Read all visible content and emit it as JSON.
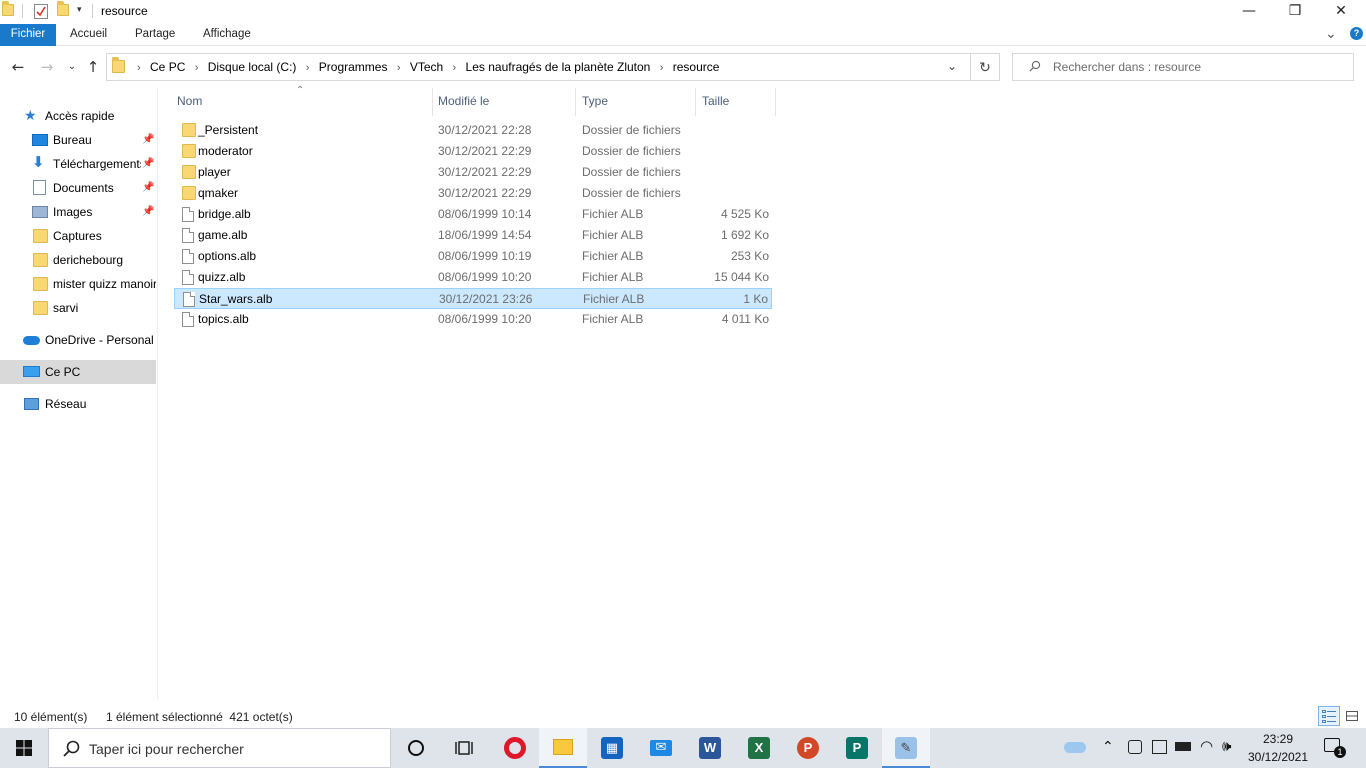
{
  "window": {
    "title": "resource",
    "minimize": "—",
    "restore": "❐",
    "close": "✕"
  },
  "ribbon": {
    "tabs": [
      "Fichier",
      "Accueil",
      "Partage",
      "Affichage"
    ],
    "expand_icon": "⌄",
    "help_icon": "?"
  },
  "address": {
    "crumbs": [
      "Ce PC",
      "Disque local (C:)",
      "Programmes",
      "VTech",
      "Les naufragés de la planète Zluton",
      "resource"
    ],
    "search_placeholder": "Rechercher dans : resource"
  },
  "nav": {
    "quick_access": "Accès rapide",
    "quick_items": [
      "Bureau",
      "Téléchargements",
      "Documents",
      "Images",
      "Captures",
      "derichebourg",
      "mister quizz manoir",
      "sarvi"
    ],
    "onedrive": "OneDrive - Personal",
    "this_pc": "Ce PC",
    "network": "Réseau"
  },
  "columns": {
    "name": "Nom",
    "modified": "Modifié le",
    "type": "Type",
    "size": "Taille"
  },
  "files": [
    {
      "name": "_Persistent",
      "date": "30/12/2021 22:28",
      "type": "Dossier de fichiers",
      "size": "",
      "kind": "folder"
    },
    {
      "name": "moderator",
      "date": "30/12/2021 22:29",
      "type": "Dossier de fichiers",
      "size": "",
      "kind": "folder"
    },
    {
      "name": "player",
      "date": "30/12/2021 22:29",
      "type": "Dossier de fichiers",
      "size": "",
      "kind": "folder"
    },
    {
      "name": "qmaker",
      "date": "30/12/2021 22:29",
      "type": "Dossier de fichiers",
      "size": "",
      "kind": "folder"
    },
    {
      "name": "bridge.alb",
      "date": "08/06/1999 10:14",
      "type": "Fichier ALB",
      "size": "4 525 Ko",
      "kind": "file"
    },
    {
      "name": "game.alb",
      "date": "18/06/1999 14:54",
      "type": "Fichier ALB",
      "size": "1 692 Ko",
      "kind": "file"
    },
    {
      "name": "options.alb",
      "date": "08/06/1999 10:19",
      "type": "Fichier ALB",
      "size": "253 Ko",
      "kind": "file"
    },
    {
      "name": "quizz.alb",
      "date": "08/06/1999 10:20",
      "type": "Fichier ALB",
      "size": "15 044 Ko",
      "kind": "file"
    },
    {
      "name": "Star_wars.alb",
      "date": "30/12/2021 23:26",
      "type": "Fichier ALB",
      "size": "1 Ko",
      "kind": "file",
      "selected": true
    },
    {
      "name": "topics.alb",
      "date": "08/06/1999 10:20",
      "type": "Fichier ALB",
      "size": "4 011 Ko",
      "kind": "file"
    }
  ],
  "status": {
    "count": "10 élément(s)",
    "selection": "1 élément sélectionné  421 octet(s)"
  },
  "taskbar": {
    "search_placeholder": "Taper ici pour rechercher",
    "time": "23:29",
    "date": "30/12/2021",
    "notification_count": "1"
  },
  "colors": {
    "accent": "#1979ca",
    "selection_bg": "#cce8ff",
    "selection_border": "#99d1ff"
  }
}
